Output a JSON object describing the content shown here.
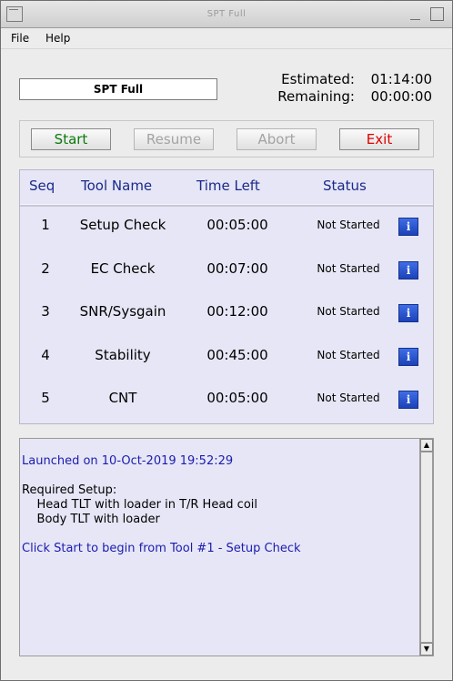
{
  "window": {
    "title": "SPT Full"
  },
  "menubar": {
    "items": [
      "File",
      "Help"
    ]
  },
  "header": {
    "protocol_name": "SPT Full",
    "estimated_label": "Estimated:",
    "estimated_value": "01:14:00",
    "remaining_label": "Remaining:",
    "remaining_value": "00:00:00"
  },
  "controls": {
    "start": "Start",
    "resume": "Resume",
    "abort": "Abort",
    "exit": "Exit"
  },
  "colors": {
    "start": "#0b7a0b",
    "exit": "#e00000",
    "header_text": "#1a2a8a",
    "log_blue": "#1c1cb0",
    "disabled": "#a3a3a3"
  },
  "table": {
    "columns": [
      "Seq",
      "Tool Name",
      "Time Left",
      "Status"
    ],
    "rows": [
      {
        "seq": "1",
        "tool": "Setup Check",
        "time_left": "00:05:00",
        "status": "Not Started"
      },
      {
        "seq": "2",
        "tool": "EC Check",
        "time_left": "00:07:00",
        "status": "Not Started"
      },
      {
        "seq": "3",
        "tool": "SNR/Sysgain",
        "time_left": "00:12:00",
        "status": "Not Started"
      },
      {
        "seq": "4",
        "tool": "Stability",
        "time_left": "00:45:00",
        "status": "Not Started"
      },
      {
        "seq": "5",
        "tool": "CNT",
        "time_left": "00:05:00",
        "status": "Not Started"
      }
    ],
    "info_icon": "info-icon",
    "info_glyph": "i"
  },
  "log": {
    "launched": "Launched on 10-Oct-2019 19:52:29",
    "required": "Required Setup:",
    "setup_1": "    Head TLT with loader in T/R Head coil",
    "setup_2": "    Body TLT with loader",
    "instruction": "Click Start to begin from Tool #1 - Setup Check"
  }
}
